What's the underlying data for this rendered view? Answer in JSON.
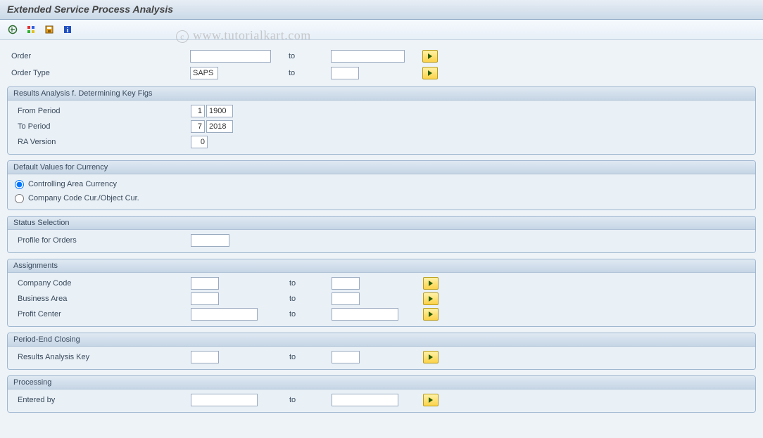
{
  "header": {
    "title": "Extended Service Process Analysis"
  },
  "watermark": "www.tutorialkart.com",
  "toolbar": {
    "icons": [
      "execute-icon",
      "variant-icon",
      "save-icon",
      "info-icon"
    ]
  },
  "top": {
    "order_label": "Order",
    "order_value": "",
    "order_to": "",
    "order_type_label": "Order Type",
    "order_type_value": "SAPS",
    "order_type_to": "",
    "to_label": "to"
  },
  "group_ra": {
    "title": "Results Analysis f. Determining Key Figs",
    "from_period_label": "From Period",
    "from_period_p": "1",
    "from_period_y": "1900",
    "to_period_label": "To Period",
    "to_period_p": "7",
    "to_period_y": "2018",
    "ra_version_label": "RA Version",
    "ra_version_value": "0"
  },
  "group_currency": {
    "title": "Default Values for Currency",
    "opt1": "Controlling Area Currency",
    "opt2": "Company Code Cur./Object Cur."
  },
  "group_status": {
    "title": "Status Selection",
    "profile_label": "Profile for Orders",
    "profile_value": ""
  },
  "group_assign": {
    "title": "Assignments",
    "to_label": "to",
    "cc_label": "Company Code",
    "cc_from": "",
    "cc_to": "",
    "ba_label": "Business Area",
    "ba_from": "",
    "ba_to": "",
    "pc_label": "Profit Center",
    "pc_from": "",
    "pc_to": ""
  },
  "group_pec": {
    "title": "Period-End Closing",
    "to_label": "to",
    "rak_label": "Results Analysis Key",
    "rak_from": "",
    "rak_to": ""
  },
  "group_proc": {
    "title": "Processing",
    "to_label": "to",
    "entered_label": "Entered by",
    "entered_from": "",
    "entered_to": ""
  }
}
